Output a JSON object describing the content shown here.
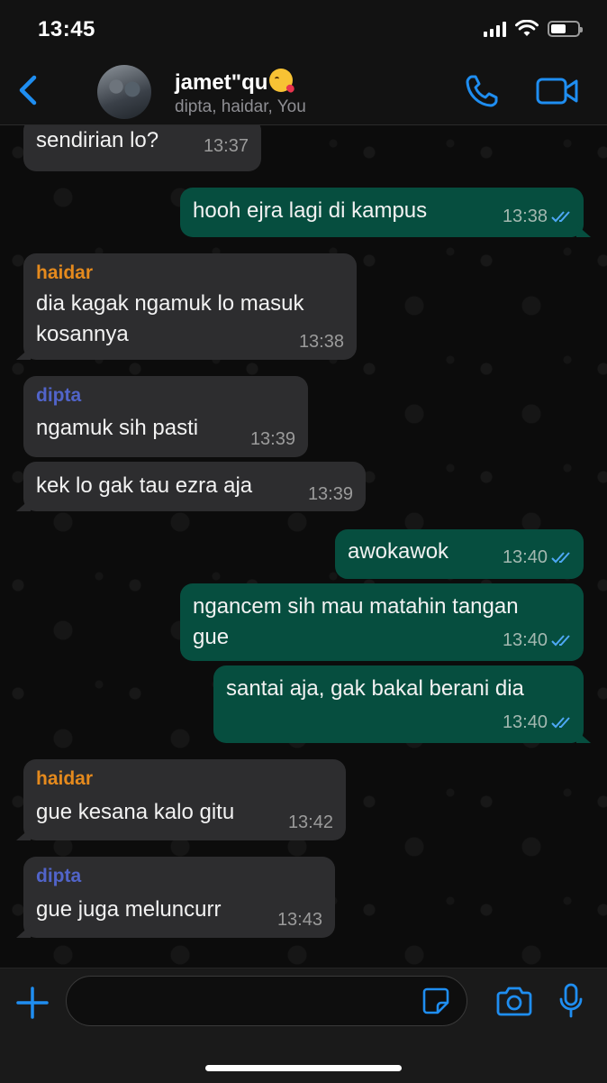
{
  "status_bar": {
    "time": "13:45"
  },
  "header": {
    "title": "jamet\"qu",
    "subtitle": "dipta, haidar, You"
  },
  "colors": {
    "accent": "#1f8ef1",
    "incoming_bubble": "#2d2d2f",
    "outgoing_bubble": "#064e3f",
    "haidar": "#e58a1d",
    "dipta": "#5164c9"
  },
  "messages": [
    {
      "direction": "in",
      "sender": "",
      "lines": [
        "sendirian lo?"
      ],
      "time": "13:37"
    },
    {
      "direction": "out",
      "sender": "",
      "lines": [
        "hooh ejra lagi di kampus"
      ],
      "time": "13:38",
      "status": "read"
    },
    {
      "direction": "in",
      "sender": "haidar",
      "lines": [
        "dia kagak ngamuk lo masuk",
        "kosannya"
      ],
      "time": "13:38"
    },
    {
      "direction": "in",
      "sender": "dipta",
      "lines": [
        "ngamuk sih pasti"
      ],
      "time": "13:39"
    },
    {
      "direction": "in",
      "sender": "",
      "lines": [
        "kek lo gak tau ezra aja"
      ],
      "time": "13:39"
    },
    {
      "direction": "out",
      "sender": "",
      "lines": [
        "awokawok"
      ],
      "time": "13:40",
      "status": "read"
    },
    {
      "direction": "out",
      "sender": "",
      "lines": [
        "ngancem sih mau matahin tangan",
        "gue"
      ],
      "time": "13:40",
      "status": "read"
    },
    {
      "direction": "out",
      "sender": "",
      "lines": [
        "santai aja, gak bakal berani dia"
      ],
      "time": "13:40",
      "status": "read"
    },
    {
      "direction": "in",
      "sender": "haidar",
      "lines": [
        "gue kesana kalo gitu"
      ],
      "time": "13:42"
    },
    {
      "direction": "in",
      "sender": "dipta",
      "lines": [
        "gue juga meluncurr"
      ],
      "time": "13:43"
    }
  ],
  "input": {
    "value": "",
    "placeholder": ""
  },
  "icons": [
    "back-chevron-icon",
    "voice-call-icon",
    "video-call-icon",
    "plus-icon",
    "sticker-icon",
    "camera-icon",
    "microphone-icon"
  ]
}
